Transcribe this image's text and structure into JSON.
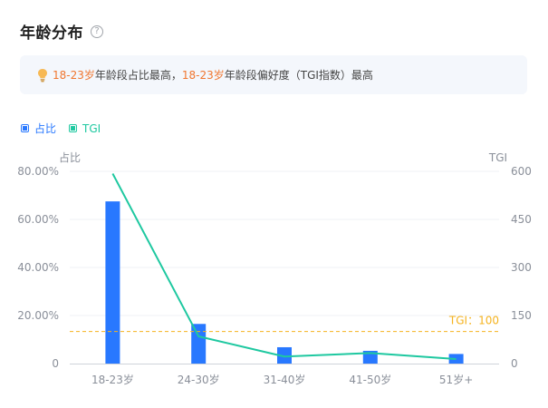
{
  "header": {
    "title": "年龄分布",
    "help_icon": "question-circle-icon"
  },
  "tip": {
    "icon": "lightbulb-icon",
    "highlight_1": "18-23岁",
    "text_1": "年龄段占比最高，",
    "highlight_2": "18-23岁",
    "text_2": "年龄段偏好度（TGI指数）最高",
    "highlight_color": "#f0762f"
  },
  "legend": [
    {
      "label": "占比",
      "color": "#2878ff"
    },
    {
      "label": "TGI",
      "color": "#1ec8a0"
    }
  ],
  "chart_data": {
    "type": "bar",
    "categories": [
      "18-23岁",
      "24-30岁",
      "31-40岁",
      "41-50岁",
      "51岁+"
    ],
    "series": [
      {
        "name": "占比",
        "type": "bar",
        "axis": "left",
        "color": "#2878ff",
        "values": [
          67.5,
          16.5,
          6.8,
          5.3,
          4.0
        ]
      },
      {
        "name": "TGI",
        "type": "line",
        "axis": "right",
        "color": "#1ec8a0",
        "values": [
          593,
          85,
          22,
          33,
          14
        ]
      }
    ],
    "left_axis": {
      "title": "占比",
      "min": 0,
      "max": 80,
      "ticks": [
        "0",
        "20.00%",
        "40.00%",
        "60.00%",
        "80.00%"
      ]
    },
    "right_axis": {
      "title": "TGI",
      "min": 0,
      "max": 600,
      "ticks": [
        "0",
        "150",
        "300",
        "450",
        "600"
      ]
    },
    "reference_line": {
      "label": "TGI：100",
      "value": 100,
      "axis": "right",
      "color": "#f5b31f"
    },
    "grid": true
  }
}
